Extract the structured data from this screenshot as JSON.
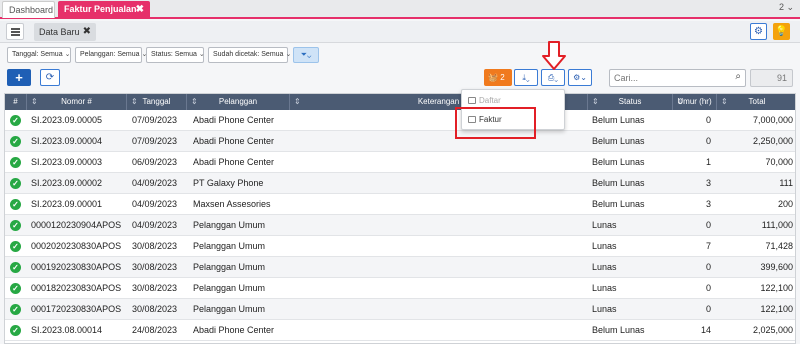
{
  "tabs": {
    "dashboard": "Dashboard",
    "active": "Faktur Penjualan",
    "count": "2"
  },
  "subtab": {
    "label": "Data Baru"
  },
  "filters": [
    {
      "label": "Tanggal: Semua"
    },
    {
      "label": "Pelanggan: Semua"
    },
    {
      "label": "Status: Semua"
    },
    {
      "label": "Sudah dicetak: Semua"
    }
  ],
  "toolbar": {
    "orange_badge": "2",
    "search_placeholder": "Cari...",
    "count": "91"
  },
  "dropdown": {
    "items": [
      {
        "label": "Daftar",
        "disabled": true
      },
      {
        "label": "Faktur",
        "disabled": false
      }
    ]
  },
  "table": {
    "headers": [
      "#",
      "Nomor #",
      "Tanggal",
      "Pelanggan",
      "Keterangan",
      "Status",
      "Umur (hr)",
      "Total"
    ],
    "rows": [
      {
        "nomor": "SI.2023.09.00005",
        "tanggal": "07/09/2023",
        "pelanggan": "Abadi Phone Center",
        "keterangan": "",
        "status": "Belum Lunas",
        "umur": "0",
        "total": "7,000,000"
      },
      {
        "nomor": "SI.2023.09.00004",
        "tanggal": "07/09/2023",
        "pelanggan": "Abadi Phone Center",
        "keterangan": "",
        "status": "Belum Lunas",
        "umur": "0",
        "total": "2,250,000"
      },
      {
        "nomor": "SI.2023.09.00003",
        "tanggal": "06/09/2023",
        "pelanggan": "Abadi Phone Center",
        "keterangan": "",
        "status": "Belum Lunas",
        "umur": "1",
        "total": "70,000"
      },
      {
        "nomor": "SI.2023.09.00002",
        "tanggal": "04/09/2023",
        "pelanggan": "PT Galaxy Phone",
        "keterangan": "",
        "status": "Belum Lunas",
        "umur": "3",
        "total": "111"
      },
      {
        "nomor": "SI.2023.09.00001",
        "tanggal": "04/09/2023",
        "pelanggan": "Maxsen Assesories",
        "keterangan": "",
        "status": "Belum Lunas",
        "umur": "3",
        "total": "200"
      },
      {
        "nomor": "0000120230904APOS",
        "tanggal": "04/09/2023",
        "pelanggan": "Pelanggan Umum",
        "keterangan": "",
        "status": "Lunas",
        "umur": "0",
        "total": "111,000"
      },
      {
        "nomor": "0002020230830APOS",
        "tanggal": "30/08/2023",
        "pelanggan": "Pelanggan Umum",
        "keterangan": "",
        "status": "Lunas",
        "umur": "7",
        "total": "71,428"
      },
      {
        "nomor": "0001920230830APOS",
        "tanggal": "30/08/2023",
        "pelanggan": "Pelanggan Umum",
        "keterangan": "",
        "status": "Lunas",
        "umur": "0",
        "total": "399,600"
      },
      {
        "nomor": "0001820230830APOS",
        "tanggal": "30/08/2023",
        "pelanggan": "Pelanggan Umum",
        "keterangan": "",
        "status": "Lunas",
        "umur": "0",
        "total": "122,100"
      },
      {
        "nomor": "0001720230830APOS",
        "tanggal": "30/08/2023",
        "pelanggan": "Pelanggan Umum",
        "keterangan": "",
        "status": "Lunas",
        "umur": "0",
        "total": "122,100"
      },
      {
        "nomor": "SI.2023.08.00014",
        "tanggal": "24/08/2023",
        "pelanggan": "Abadi Phone Center",
        "keterangan": "",
        "status": "Belum Lunas",
        "umur": "14",
        "total": "2,025,000"
      }
    ]
  },
  "icons": {
    "list": "list-icon",
    "close": "close-icon",
    "gear": "gear-icon",
    "bulb": "lightbulb-icon",
    "filter": "filter-icon",
    "refresh": "refresh-icon",
    "basket": "basket-icon",
    "download": "download-icon",
    "print": "print-icon",
    "settings": "settings-icon",
    "search": "search-icon",
    "check": "check-circle-icon",
    "arrow": "arrow-down-icon"
  },
  "colors": {
    "accent": "#e6306a",
    "primary": "#1f5fb5",
    "header": "#4b5b73",
    "success": "#27a844",
    "orange": "#f07a1e",
    "warning": "#f4a20c",
    "highlight": "#e21f26"
  }
}
